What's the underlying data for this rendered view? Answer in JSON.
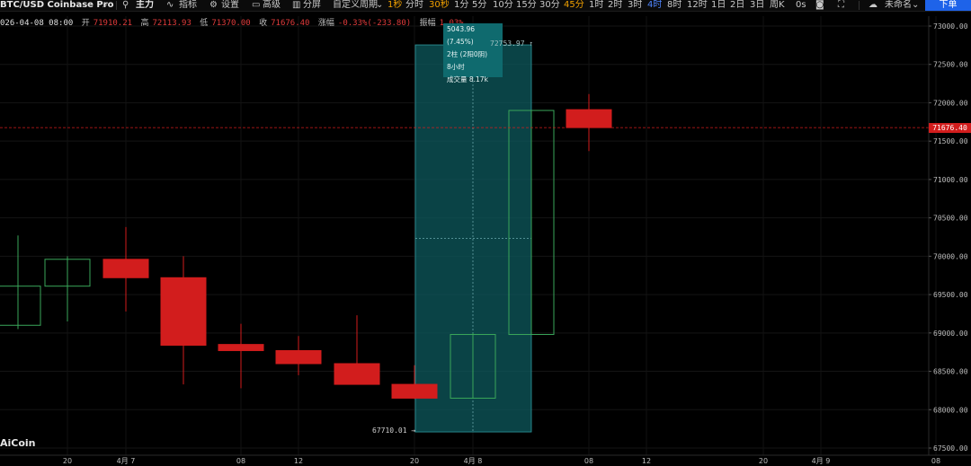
{
  "toolbar": {
    "symbol": "BTC/USD Coinbase Pro",
    "main_indicator": "主力",
    "indicators": "指标",
    "settings": "设置",
    "advanced": "高级",
    "split": "分屏",
    "custom_period": "自定义周期",
    "periods": [
      "1秒",
      "分时",
      "30秒",
      "1分",
      "5分",
      "10分",
      "15分",
      "30分",
      "45分",
      "1时",
      "2时",
      "3时",
      "4时",
      "8时",
      "12时",
      "1日",
      "2日",
      "3日",
      "周K",
      "0s"
    ],
    "active_period": "4时",
    "unnamed": "未命名",
    "order_button": "下单"
  },
  "ohlc": {
    "datetime": "026-04-08 08:00",
    "open_label": "开",
    "open": "71910.21",
    "high_label": "高",
    "high": "72113.93",
    "low_label": "低",
    "low": "71370.00",
    "close_label": "收",
    "close": "71676.40",
    "change_label": "涨幅",
    "change": "-0.33%(-233.80)",
    "amplitude_label": "振幅",
    "amplitude": "1.03%"
  },
  "tooltip": {
    "line1": "5043.96 (7.45%)",
    "line2": "2柱 (2阳0阴)",
    "line3": "8小时",
    "line4": "成交量 8.17k"
  },
  "current_price_label": "71676.40",
  "range_low_label": "67710.01 →",
  "range_high_label": "72753.97 ↑",
  "logo": "AiCoin",
  "colors": {
    "up": "#3aa65a",
    "down": "#d21d1d",
    "measure_fill": "#0e5a5e",
    "accent": "#1e63e9"
  },
  "chart_data": {
    "type": "candlestick",
    "price_axis": {
      "ticks": [
        "73000.00",
        "72500.00",
        "72000.00",
        "71500.00",
        "71000.00",
        "70500.00",
        "70000.00",
        "69500.00",
        "69000.00",
        "68500.00",
        "68000.00",
        "67500.00"
      ],
      "ylim": [
        67500,
        73000
      ]
    },
    "time_axis": {
      "ticks": [
        "20",
        "4月 7",
        "08",
        "12",
        "20",
        "4月 8",
        "08",
        "12",
        "20",
        "4月 9",
        "08"
      ]
    },
    "candles": [
      {
        "o": 69100,
        "h": 70270,
        "l": 69050,
        "c": 69610
      },
      {
        "o": 69610,
        "h": 70000,
        "l": 69150,
        "c": 69960
      },
      {
        "o": 69960,
        "h": 70380,
        "l": 69280,
        "c": 69720
      },
      {
        "o": 69720,
        "h": 70000,
        "l": 68330,
        "c": 68840
      },
      {
        "o": 68850,
        "h": 69120,
        "l": 68280,
        "c": 68770
      },
      {
        "o": 68770,
        "h": 68960,
        "l": 68450,
        "c": 68600
      },
      {
        "o": 68600,
        "h": 69230,
        "l": 68360,
        "c": 68330
      },
      {
        "o": 68330,
        "h": 68580,
        "l": 68140,
        "c": 68150
      },
      {
        "o": 68150,
        "h": 69000,
        "l": 68150,
        "c": 68980
      },
      {
        "o": 68980,
        "h": 71900,
        "l": 68980,
        "c": 71900
      },
      {
        "o": 71910.21,
        "h": 72113.93,
        "l": 71370.0,
        "c": 71676.4
      }
    ],
    "measure": {
      "low": 67710.01,
      "high": 72753.97
    },
    "current_price": 71676.4
  }
}
